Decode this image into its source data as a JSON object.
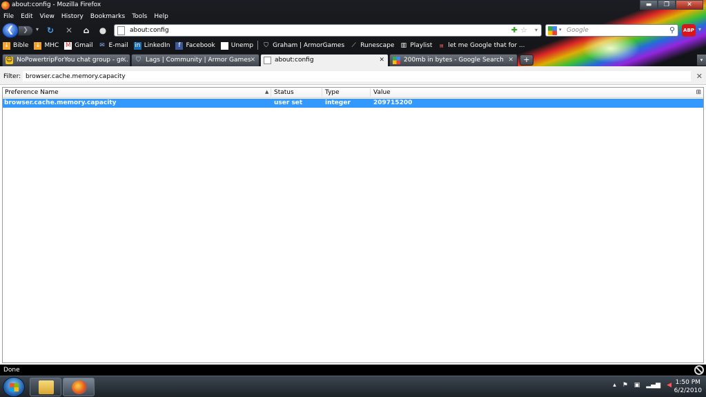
{
  "window": {
    "title": "about:config - Mozilla Firefox",
    "controls": {
      "minimize": "▬",
      "maximize": "❐",
      "close": "✕"
    }
  },
  "menu": [
    "File",
    "Edit",
    "View",
    "History",
    "Bookmarks",
    "Tools",
    "Help"
  ],
  "navigation": {
    "url": "about:config",
    "search_placeholder": "Google",
    "adblock_label": "ABP"
  },
  "bookmarks": [
    {
      "label": "Bible",
      "icon": "bookmark-icon"
    },
    {
      "label": "MHC",
      "icon": "bookmark-icon"
    },
    {
      "label": "Gmail",
      "icon": "gmail-icon"
    },
    {
      "label": "E-mail",
      "icon": "email-icon"
    },
    {
      "label": "LinkedIn",
      "icon": "linkedin-icon"
    },
    {
      "label": "Facebook",
      "icon": "facebook-icon"
    },
    {
      "label": "Unemp",
      "icon": "page-icon"
    },
    {
      "label": "Graham | ArmorGames",
      "icon": "shield-icon"
    },
    {
      "label": "Runescape",
      "icon": "sword-icon"
    },
    {
      "label": "Playlist",
      "icon": "playlist-icon"
    },
    {
      "label": "let me Google that for ...",
      "icon": "lmgtfy-icon"
    }
  ],
  "tabs": [
    {
      "label": "NoPowertripForYou chat group - gr...",
      "icon": "smiley-icon",
      "active": false
    },
    {
      "label": "Lags | Community | Armor Games",
      "icon": "shield-icon",
      "active": false
    },
    {
      "label": "about:config",
      "icon": "page-icon",
      "active": true
    },
    {
      "label": "200mb in bytes - Google Search",
      "icon": "google-icon",
      "active": false
    }
  ],
  "filter": {
    "label": "Filter:",
    "value": "browser.cache.memory.capacity"
  },
  "grid": {
    "columns": [
      "Preference Name",
      "Status",
      "Type",
      "Value"
    ],
    "rows": [
      {
        "name": "browser.cache.memory.capacity",
        "status": "user set",
        "type": "integer",
        "value": "209715200"
      }
    ]
  },
  "status": {
    "text": "Done"
  },
  "taskbar": {
    "time": "1:50 PM",
    "date": "6/2/2010"
  },
  "colors": {
    "selection": "#3399ff",
    "chrome": "#1b1d22"
  }
}
